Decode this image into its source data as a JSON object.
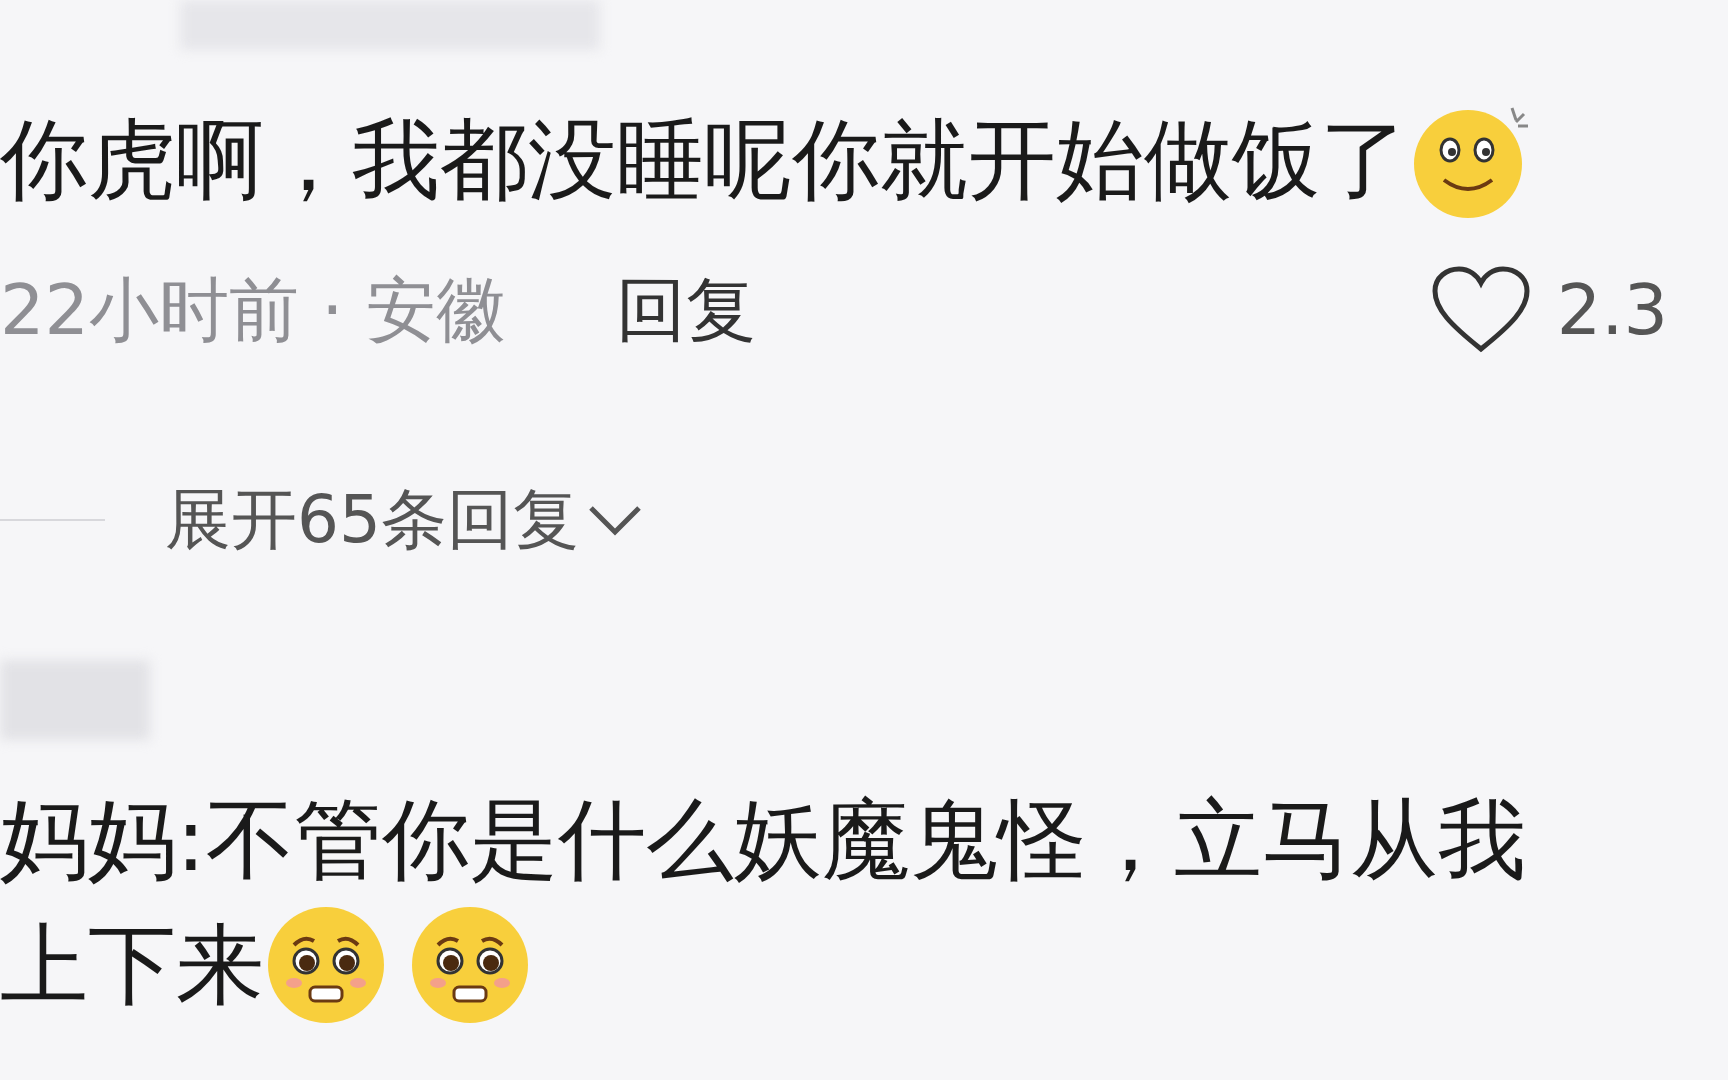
{
  "comment": {
    "text": "你虎啊，我都没睡呢你就开始做饭了",
    "meta": "22小时前 · 安徽",
    "reply": "回复",
    "likes": "2.3"
  },
  "expand": {
    "label": "展开65条回复"
  },
  "comment_2": {
    "lines": [
      "妈妈:不管你是什么妖魔鬼怪，立马从我",
      "上下来"
    ]
  }
}
